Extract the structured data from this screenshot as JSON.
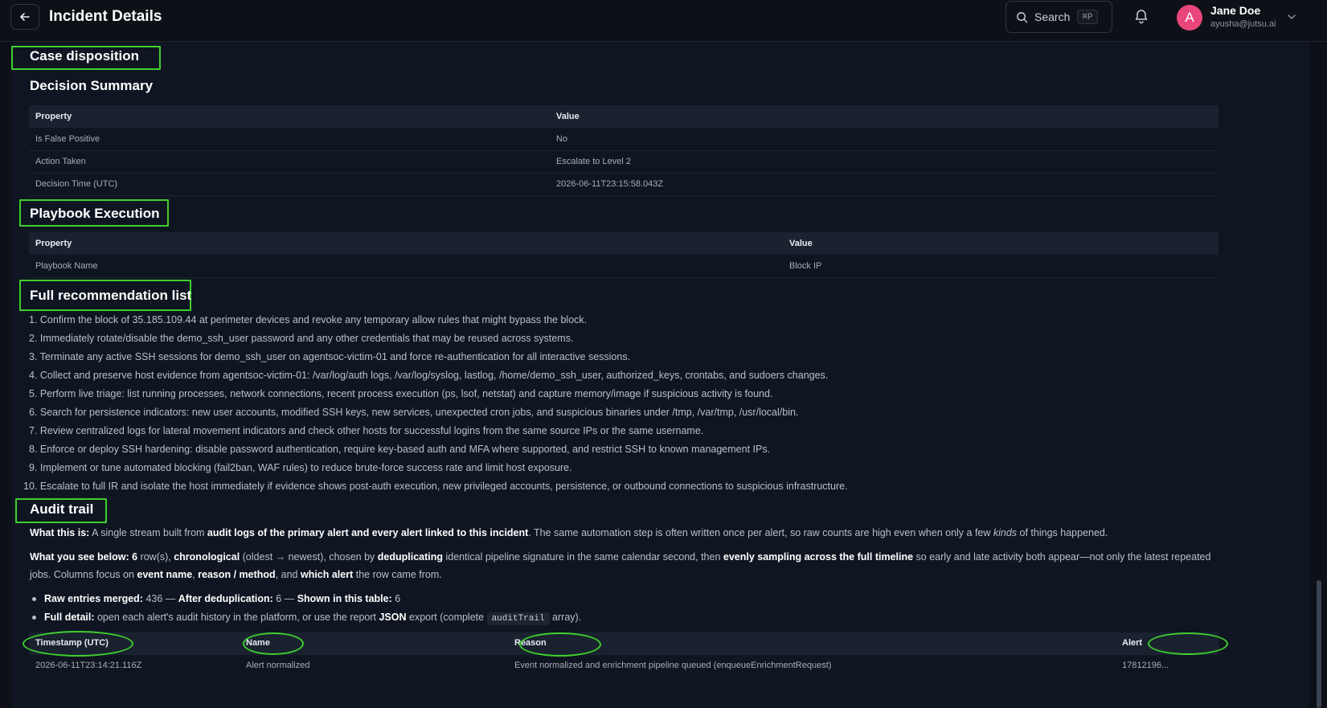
{
  "header": {
    "title": "Incident Details",
    "search_label": "Search",
    "search_shortcut": "⌘P",
    "user_initial": "A",
    "user_name": "Jane Doe",
    "user_email": "ayusha@jutsu.ai"
  },
  "case_disposition": {
    "title": "Case disposition",
    "decision_summary": {
      "title": "Decision Summary",
      "columns": [
        "Property",
        "Value"
      ],
      "rows": [
        [
          "Is False Positive",
          "No"
        ],
        [
          "Action Taken",
          "Escalate to Level 2"
        ],
        [
          "Decision Time (UTC)",
          "2026-06-11T23:15:58.043Z"
        ]
      ]
    }
  },
  "playbook": {
    "title": "Playbook Execution",
    "columns": [
      "Property",
      "Value"
    ],
    "rows": [
      [
        "Playbook Name",
        "Block IP"
      ]
    ]
  },
  "recommendations": {
    "title": "Full recommendation list",
    "items": [
      "1. Confirm the block of 35.185.109.44 at perimeter devices and revoke any temporary allow rules that might bypass the block.",
      "2. Immediately rotate/disable the demo_ssh_user password and any other credentials that may be reused across systems.",
      "3. Terminate any active SSH sessions for demo_ssh_user on agentsoc-victim-01 and force re-authentication for all interactive sessions.",
      "4. Collect and preserve host evidence from agentsoc-victim-01: /var/log/auth logs, /var/log/syslog, lastlog, /home/demo_ssh_user, authorized_keys, crontabs, and sudoers changes.",
      "5. Perform live triage: list running processes, network connections, recent process execution (ps, lsof, netstat) and capture memory/image if suspicious activity is found.",
      "6. Search for persistence indicators: new user accounts, modified SSH keys, new services, unexpected cron jobs, and suspicious binaries under /tmp, /var/tmp, /usr/local/bin.",
      "7. Review centralized logs for lateral movement indicators and check other hosts for successful logins from the same source IPs or the same username.",
      "8. Enforce or deploy SSH hardening: disable password authentication, require key-based auth and MFA where supported, and restrict SSH to known management IPs.",
      "9. Implement or tune automated blocking (fail2ban, WAF rules) to reduce brute-force success rate and limit host exposure.",
      "10. Escalate to full IR and isolate the host immediately if evidence shows post-auth execution, new privileged accounts, persistence, or outbound connections to suspicious infrastructure."
    ]
  },
  "audit": {
    "title": "Audit trail",
    "what_label": "What this is:",
    "what_t1": " A single stream built from ",
    "what_b1": "audit logs of the primary alert and every alert linked to this incident",
    "what_t2": ". The same automation step is often written once per alert, so raw counts are high even when only a few ",
    "what_i1": "kinds",
    "what_t3": " of things happened.",
    "see_label": "What you see below:",
    "see_b_count": "6",
    "see_t1": " row(s), ",
    "see_b_chrono": "chronological",
    "see_t2": " (oldest → newest), chosen by ",
    "see_b_dedup": "deduplicating",
    "see_t3": " identical pipeline signature in the same calendar second, then ",
    "see_b_sample": "evenly sampling across the full timeline",
    "see_t4": " so early and late activity both appear—not only the latest repeated jobs. Columns focus on ",
    "see_b_event": "event name",
    "see_t5": ", ",
    "see_b_reason": "reason / method",
    "see_t6": ", and ",
    "see_b_which": "which alert",
    "see_t7": " the row came from.",
    "b1_label1": "Raw entries merged:",
    "b1_v1": " 436 — ",
    "b1_label2": "After deduplication:",
    "b1_v2": " 6 — ",
    "b1_label3": "Shown in this table:",
    "b1_v3": " 6",
    "b2_label": "Full detail:",
    "b2_t1": " open each alert's audit history in the platform, or use the report ",
    "b2_json": "JSON",
    "b2_t2": " export (complete ",
    "b2_code": "auditTrail",
    "b2_t3": " array).",
    "columns": {
      "timestamp": "Timestamp (UTC)",
      "name": "Name",
      "reason": "Reason",
      "alert": "Alert"
    },
    "rows": [
      {
        "timestamp": "2026-06-11T23:14:21.116Z",
        "name": "Alert normalized",
        "reason": "Event normalized and enrichment pipeline queued (enqueueEnrichmentRequest)",
        "alert": "17812196..."
      }
    ]
  },
  "colors": {
    "background": "#0d1117",
    "panel": "#0f1622",
    "highlight_green": "#3fcf2e",
    "avatar": "#e8467a"
  }
}
